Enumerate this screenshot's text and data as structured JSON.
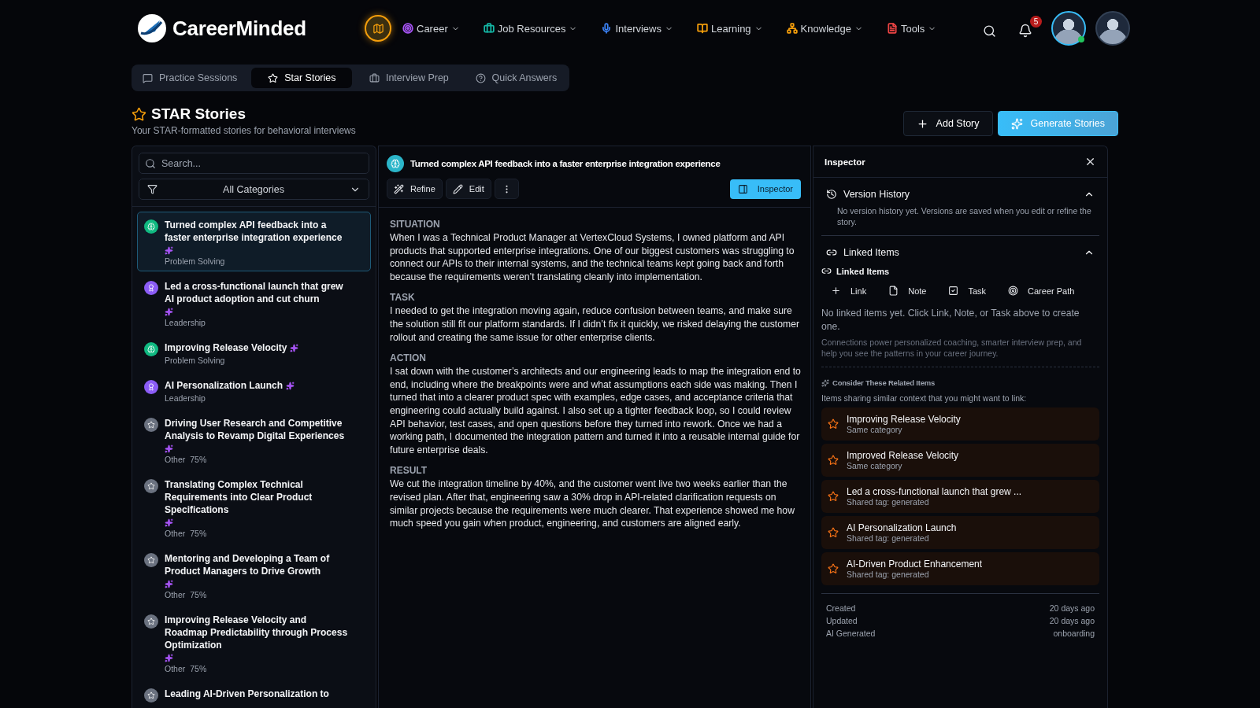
{
  "brand": {
    "name": "CareerMinded"
  },
  "nav": [
    {
      "label": "Career",
      "color": "#a855f7",
      "kind": "target"
    },
    {
      "label": "Job Resources",
      "color": "#14b8a6",
      "kind": "briefcase"
    },
    {
      "label": "Interviews",
      "color": "#3b82f6",
      "kind": "mic"
    },
    {
      "label": "Learning",
      "color": "#f59e0b",
      "kind": "book"
    },
    {
      "label": "Knowledge",
      "color": "#f59e0b",
      "kind": "tree"
    },
    {
      "label": "Tools",
      "color": "#ef4444",
      "kind": "file"
    }
  ],
  "notifications": {
    "count": "5"
  },
  "tabs": [
    {
      "label": "Practice Sessions",
      "kind": "chat",
      "selected": false
    },
    {
      "label": "Star Stories",
      "kind": "star",
      "selected": true
    },
    {
      "label": "Interview Prep",
      "kind": "briefcase",
      "selected": false
    },
    {
      "label": "Quick Answers",
      "kind": "help",
      "selected": false
    }
  ],
  "page": {
    "title": "STAR Stories",
    "subtitle": "Your STAR-formatted stories for behavioral interviews",
    "buttons": [
      {
        "label": "Add Story",
        "kind": "secondary"
      },
      {
        "label": "Generate Stories",
        "kind": "primary"
      }
    ]
  },
  "search": {
    "placeholder": "Search..."
  },
  "filter": {
    "value": "All Categories"
  },
  "stories": [
    {
      "title": "Turned complex API feedback into a faster enterprise integration experience",
      "category": "Problem Solving",
      "kind": "problem",
      "selected": true
    },
    {
      "title": "Led a cross-functional launch that grew AI product adoption and cut churn",
      "category": "Leadership",
      "kind": "leadership",
      "selected": false
    },
    {
      "title": "Improving Release Velocity",
      "category": "Problem Solving",
      "kind": "problem",
      "selected": false
    },
    {
      "title": "AI Personalization Launch",
      "category": "Leadership",
      "kind": "leadership",
      "selected": false
    },
    {
      "title": "Driving User Research and Competitive Analysis to Revamp Digital Experiences",
      "category": "Other",
      "score": "75%",
      "kind": "other",
      "selected": false
    },
    {
      "title": "Translating Complex Technical Requirements into Clear Product Specifications",
      "category": "Other",
      "score": "75%",
      "kind": "other",
      "selected": false
    },
    {
      "title": "Mentoring and Developing a Team of Product Managers to Drive Growth",
      "category": "Other",
      "score": "75%",
      "kind": "other",
      "selected": false
    },
    {
      "title": "Improving Release Velocity and Roadmap Predictability through Process Optimization",
      "category": "Other",
      "score": "75%",
      "kind": "other",
      "selected": false
    },
    {
      "title": "Leading AI-Driven Personalization to",
      "kind": "other",
      "selected": false
    }
  ],
  "detail": {
    "title": "Turned complex API feedback into a faster enterprise integration experience",
    "actions": [
      {
        "label": "Refine",
        "kind": "wand"
      },
      {
        "label": "Edit",
        "kind": "pen"
      }
    ],
    "inspector_button": {
      "label": "Inspector",
      "on": true
    },
    "sections": [
      {
        "heading": "SITUATION",
        "text": "When I was a Technical Product Manager at VertexCloud Systems, I owned platform and API products that supported enterprise integrations. One of our biggest customers was struggling to connect our APIs to their internal systems, and the technical teams kept going back and forth because the requirements weren’t translating cleanly into implementation."
      },
      {
        "heading": "TASK",
        "text": "I needed to get the integration moving again, reduce confusion between teams, and make sure the solution still fit our platform standards. If I didn’t fix it quickly, we risked delaying the customer rollout and creating the same issue for other enterprise clients."
      },
      {
        "heading": "ACTION",
        "text": "I sat down with the customer’s architects and our engineering leads to map the integration end to end, including where the breakpoints were and what assumptions each side was making. Then I turned that into a clearer product spec with examples, edge cases, and acceptance criteria that engineering could actually build against. I also set up a tighter feedback loop, so I could review API behavior, test cases, and open questions before they turned into rework. Once we had a working path, I documented the integration pattern and turned it into a reusable internal guide for future enterprise deals."
      },
      {
        "heading": "RESULT",
        "text": "We cut the integration timeline by 40%, and the customer went live two weeks earlier than the revised plan. After that, engineering saw a 30% drop in API-related clarification requests on similar projects because the requirements were much clearer. That experience showed me how much speed you gain when product, engineering, and customers are aligned early."
      }
    ]
  },
  "inspector": {
    "title": "Inspector",
    "version_history": {
      "title": "Version History",
      "expanded": true,
      "text": "No version history yet. Versions are saved when you edit or refine the story."
    },
    "linked_items": {
      "title": "Linked Items",
      "expanded": true,
      "subtitle": "Linked Items",
      "actions": [
        {
          "label": "Link",
          "kind": "plus"
        },
        {
          "label": "Note",
          "kind": "note"
        },
        {
          "label": "Task",
          "kind": "task"
        },
        {
          "label": "Career Path",
          "kind": "target"
        }
      ],
      "empty": "No linked items yet. Click Link, Note, or Task above to create one.",
      "hint": "Connections power personalized coaching, smarter interview prep, and help you see the patterns in your career journey."
    },
    "related": {
      "title": "Consider These Related Items",
      "subtitle": "Items sharing similar context that you might want to link:",
      "items": [
        {
          "title": "Improving Release Velocity",
          "reason": "Same category"
        },
        {
          "title": "Improved Release Velocity",
          "reason": "Same category"
        },
        {
          "title": "Led a cross-functional launch that grew ...",
          "reason": "Shared tag: generated"
        },
        {
          "title": "AI Personalization Launch",
          "reason": "Shared tag: generated"
        },
        {
          "title": "AI-Driven Product Enhancement",
          "reason": "Shared tag: generated"
        }
      ]
    },
    "meta": [
      {
        "label": "Created",
        "value": "20 days ago"
      },
      {
        "label": "Updated",
        "value": "20 days ago"
      },
      {
        "label": "AI Generated",
        "value": "onboarding"
      }
    ]
  }
}
